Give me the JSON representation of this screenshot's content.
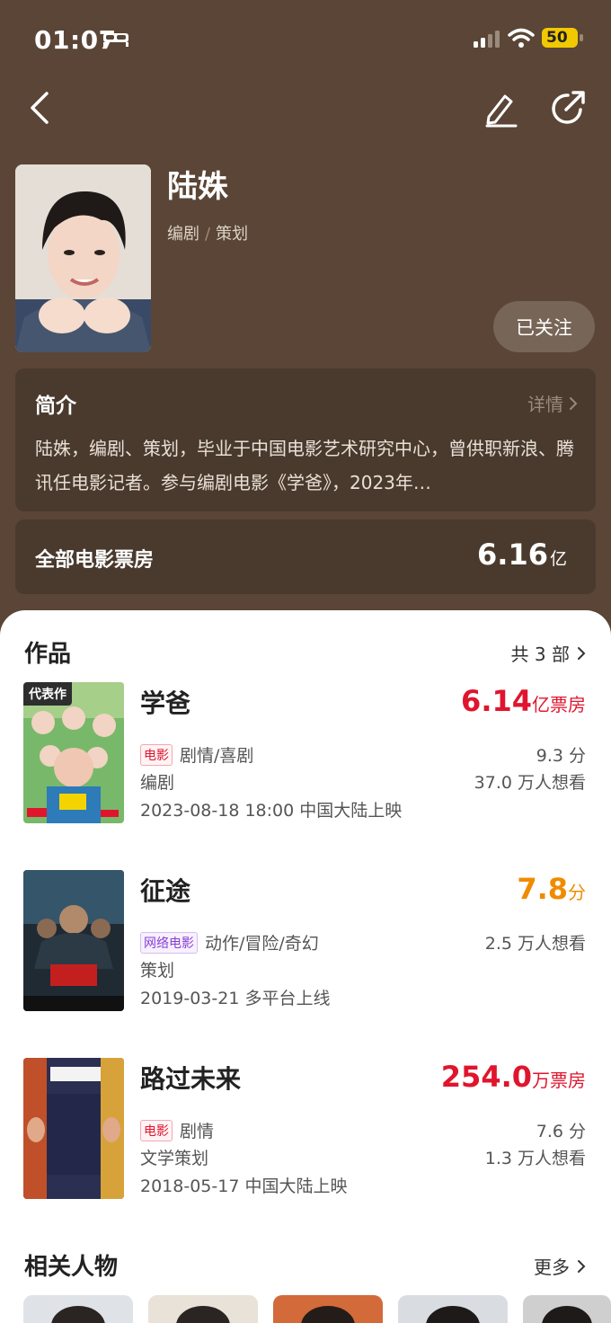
{
  "status_bar": {
    "time": "01:07",
    "battery": "50"
  },
  "profile": {
    "name": "陆姝",
    "roles": [
      "编剧",
      "策划"
    ],
    "follow_label": "已关注"
  },
  "intro": {
    "title": "简介",
    "detail_label": "详情",
    "text": "陆姝，编剧、策划，毕业于中国电影艺术研究中心，曾供职新浪、腾讯任电影记者。参与编剧电影《学爸》，2023年…"
  },
  "box_office": {
    "label": "全部电影票房",
    "value": "6.16",
    "unit": "亿"
  },
  "works": {
    "title": "作品",
    "count_label": "共 3 部",
    "items": [
      {
        "title": "学爸",
        "poster_tag": "代表作",
        "metric_value": "6.14",
        "metric_unit": "亿票房",
        "metric_color": "#e0152d",
        "type_tag": "电影",
        "genres": "剧情/喜剧",
        "role": "编剧",
        "release": "2023-08-18 18:00 中国大陆上映",
        "score": "9.3 分",
        "want": "37.0 万人想看"
      },
      {
        "title": "征途",
        "metric_value": "7.8",
        "metric_unit": "分",
        "metric_color": "#f08b00",
        "type_tag": "网络电影",
        "genres": "动作/冒险/奇幻",
        "role": "策划",
        "release": "2019-03-21 多平台上线",
        "want": "2.5 万人想看"
      },
      {
        "title": "路过未来",
        "metric_value": "254.0",
        "metric_unit": "万票房",
        "metric_color": "#e0152d",
        "type_tag": "电影",
        "genres": "剧情",
        "role": "文学策划",
        "release": "2018-05-17 中国大陆上映",
        "score": "7.6 分",
        "want": "1.3 万人想看"
      }
    ]
  },
  "related": {
    "title": "相关人物",
    "more_label": "更多"
  },
  "colors": {
    "header_bg": "#5a4536",
    "card_bg": "#4a3a2e",
    "accent_red": "#e0152d",
    "accent_orange": "#f08b00"
  }
}
